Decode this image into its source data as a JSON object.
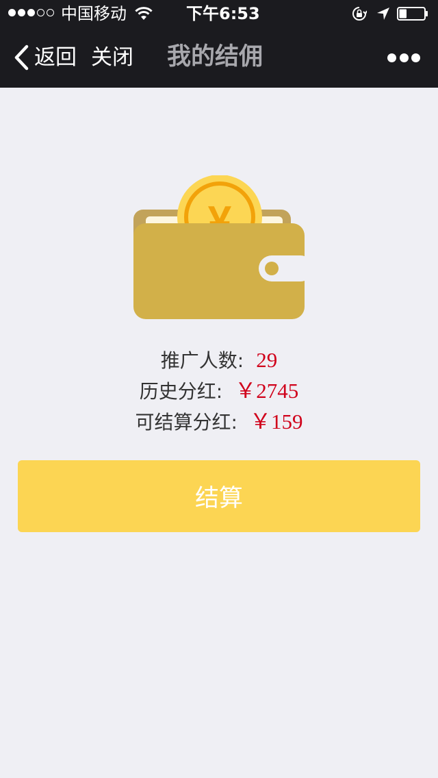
{
  "status_bar": {
    "signal_dots": [
      "full",
      "full",
      "full",
      "empty",
      "empty"
    ],
    "carrier": "中国移动",
    "time": "下午6:53",
    "battery_level": 0.3
  },
  "nav": {
    "back_label": "返回",
    "close_label": "关闭",
    "title": "我的结佣"
  },
  "wallet": {
    "currency_symbol": "¥"
  },
  "stats": [
    {
      "label": "推广人数:",
      "value": "29"
    },
    {
      "label": "历史分红:",
      "value": "￥2745"
    },
    {
      "label": "可结算分红:",
      "value": "￥159"
    }
  ],
  "settle_button": {
    "label": "结算"
  },
  "colors": {
    "nav_bg": "#1b1b1f",
    "page_bg": "#efeff4",
    "value_red": "#d0021b",
    "button_yellow": "#fcd553",
    "wallet_gold": "#d2b049",
    "wallet_back": "#c2a35a",
    "coin_outer": "#fcd654",
    "coin_ring": "#f2a20a"
  }
}
